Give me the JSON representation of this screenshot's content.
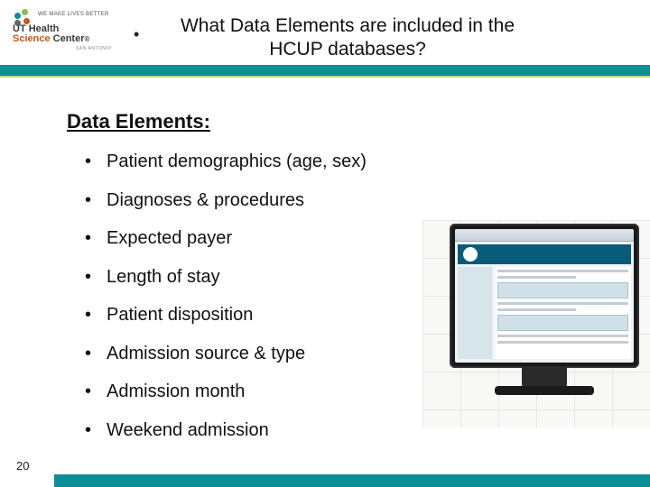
{
  "logo": {
    "tagline_line1": "WE MAKE LIVES BETTER",
    "name_line1": "UT Health",
    "name_line2_orange": "Science",
    "name_line2_rest": " Center",
    "campus": "SAN ANTONIO"
  },
  "title_line1": "What Data Elements are included in the",
  "title_line2": "HCUP databases?",
  "section_heading": "Data Elements:",
  "bullets": [
    "Patient demographics (age, sex)",
    "Diagnoses & procedures",
    "Expected payer",
    "Length of stay",
    "Patient disposition",
    "Admission source & type",
    "Admission month",
    "Weekend admission"
  ],
  "page_number": "20"
}
